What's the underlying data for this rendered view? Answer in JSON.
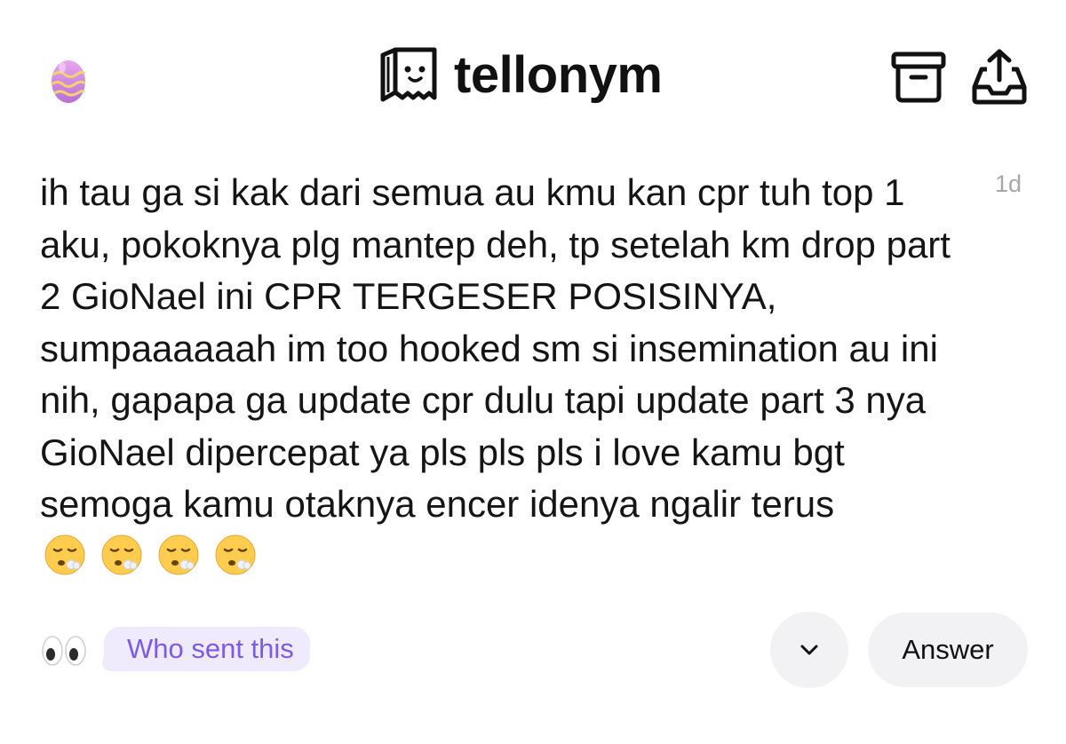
{
  "header": {
    "brand": "tellonym",
    "left_icon": "easter-egg-icon",
    "archive_icon": "archive-box-icon",
    "share_icon": "share-tray-icon"
  },
  "tell": {
    "timestamp": "1d",
    "text": "ih tau ga si kak dari semua au kmu kan cpr tuh top 1 aku, pokoknya plg mantep deh, tp setelah km drop part 2 GioNael ini CPR TERGESER POSISINYA, sumpaaaaaah im too hooked sm si insemination au ini nih, gapapa ga update cpr dulu tapi update part 3 nya GioNael dipercepat ya pls pls pls i love kamu bgt semoga kamu otaknya encer idenya ngalir terus",
    "emojis": [
      "😮‍💨",
      "😮‍💨",
      "😮‍💨",
      "😮‍💨"
    ]
  },
  "actions": {
    "eyes_icon": "eyes-icon",
    "who_sent_label": "Who sent this",
    "answer_label": "Answer",
    "more_icon": "chevron-down-icon"
  },
  "colors": {
    "accent": "#7b5ce8",
    "pill_bg": "#efeafc",
    "button_bg": "#f2f2f4",
    "timestamp": "#a7a7ab"
  }
}
